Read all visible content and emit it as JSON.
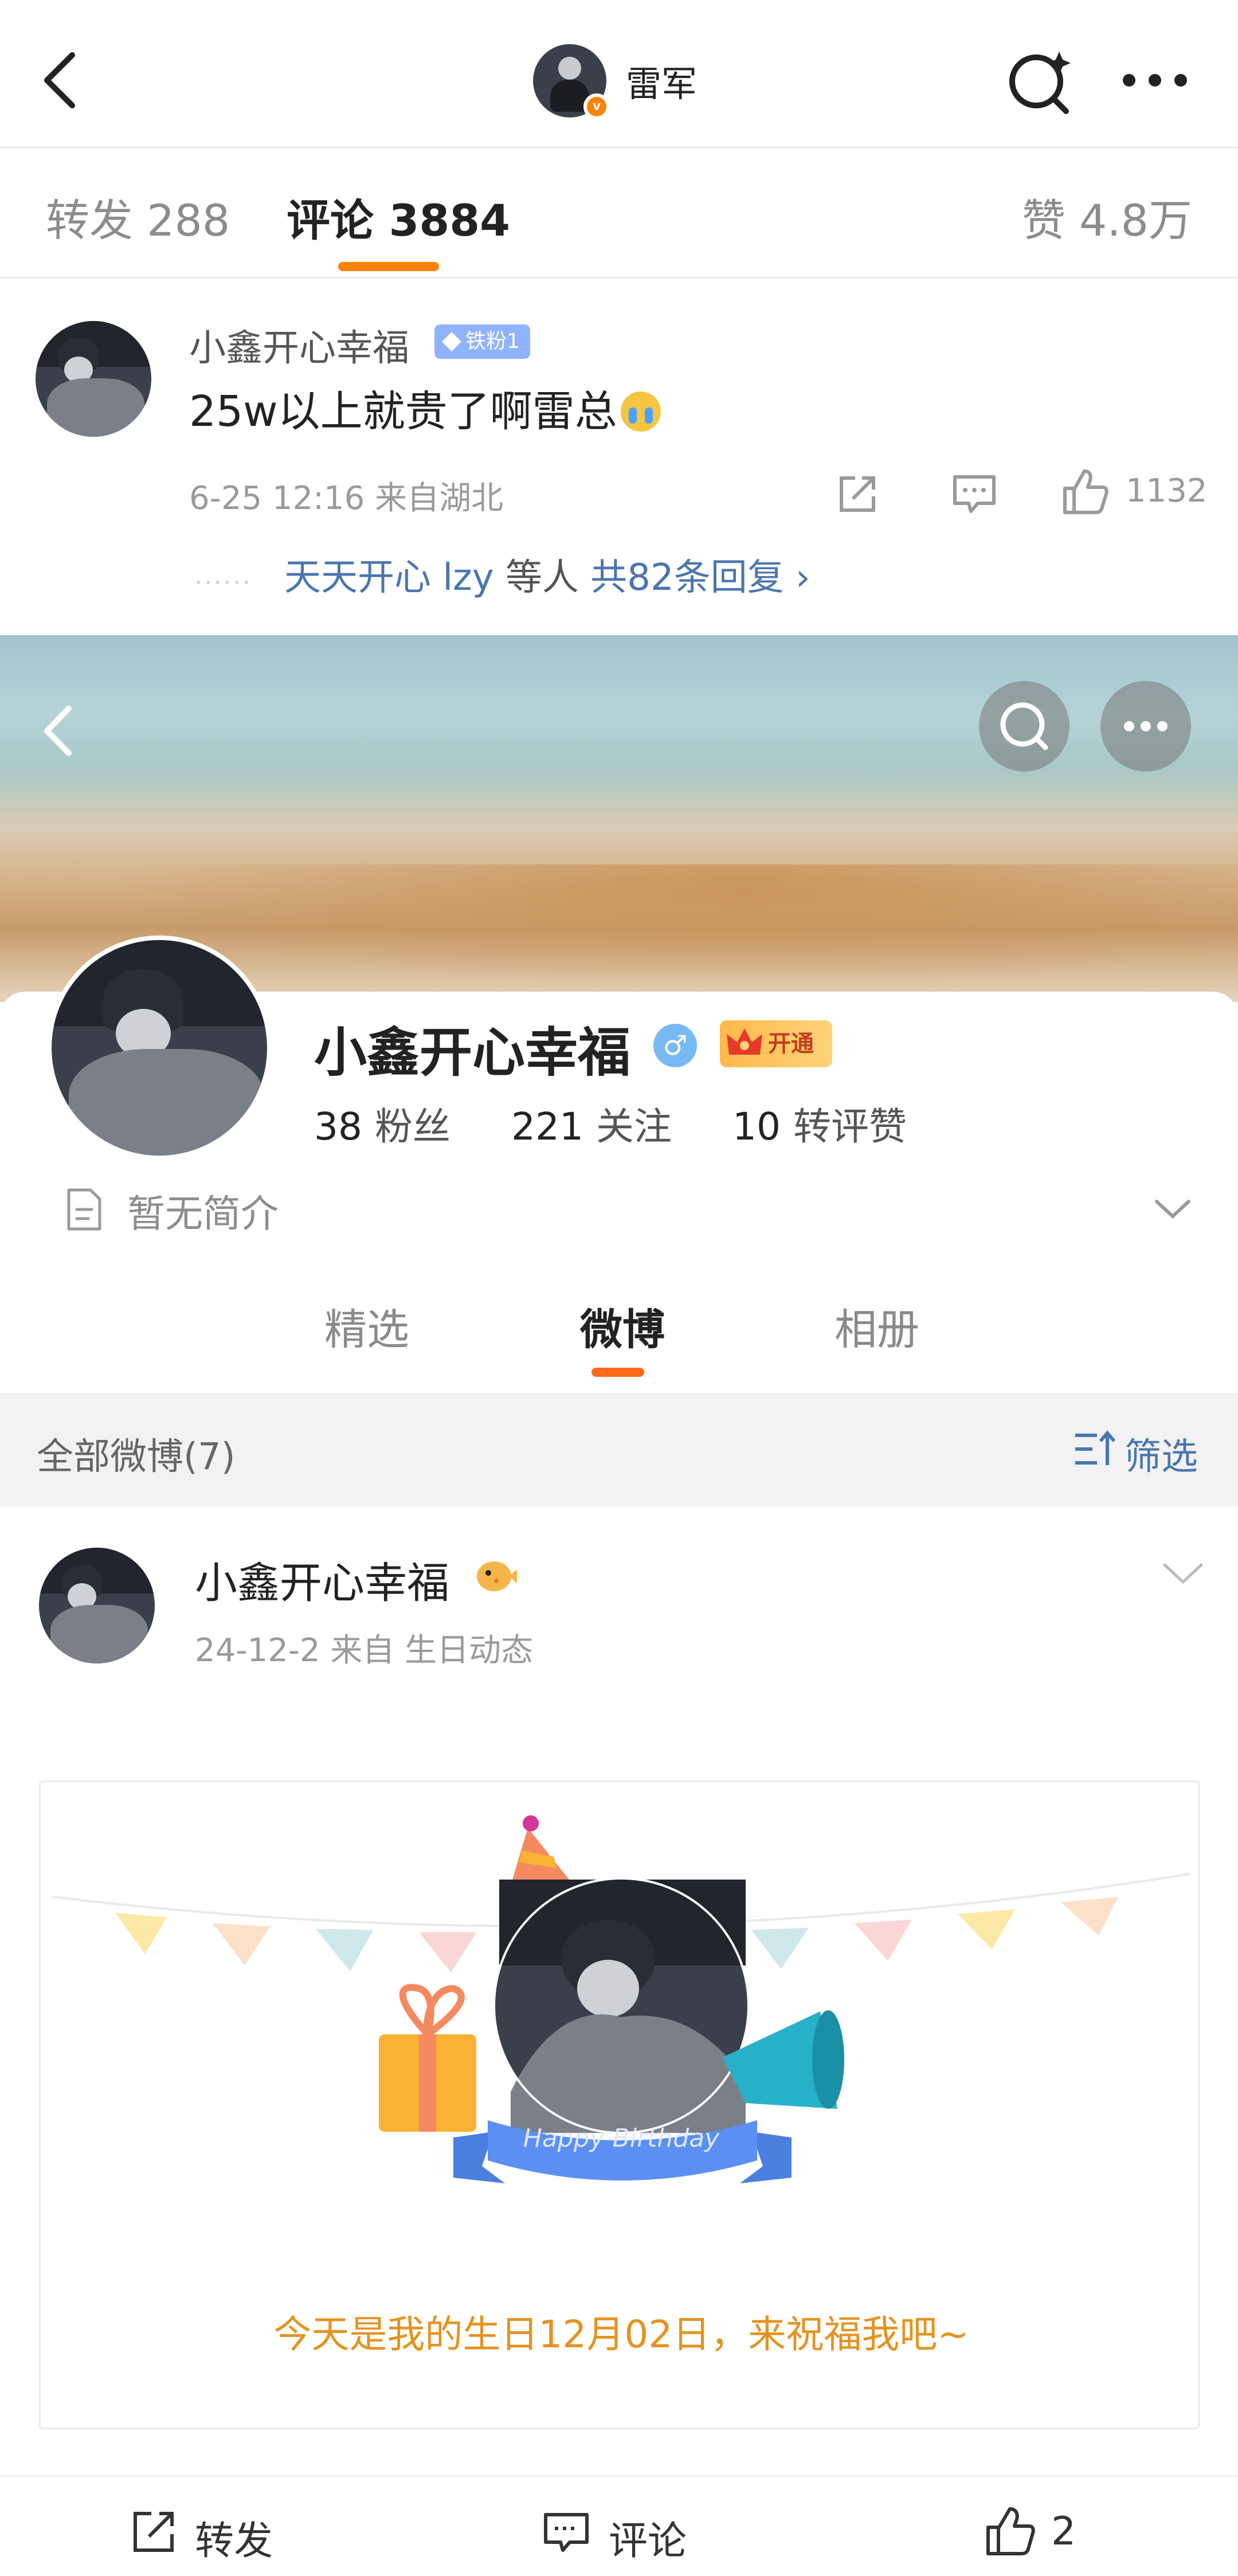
{
  "nav": {
    "username": "雷军",
    "verified_badge": "v"
  },
  "tabs": {
    "forward": "转发 288",
    "comments": "评论 3884",
    "likes": "赞 4.8万"
  },
  "comment": {
    "user": "小鑫开心幸福",
    "fan_badge": "铁粉1",
    "text": "25w以上就贵了啊雷总",
    "meta": "6-25 12:16  来自湖北",
    "like_count": "1132",
    "dots": "······",
    "replies_user": "天天开心 lzy",
    "replies_mid": " 等人 ",
    "replies_total": "共82条回复 ›"
  },
  "profile": {
    "name": "小鑫开心幸福",
    "gender": "♂",
    "vip_label": "开通",
    "followers_n": "38",
    "followers_label": "粉丝",
    "following_n": "221",
    "following_label": "关注",
    "engagement_n": "10",
    "engagement_label": "转评赞",
    "bio": "暂无简介",
    "tabs": [
      "精选",
      "微博",
      "相册"
    ]
  },
  "filter": {
    "all_posts": "全部微博(7)",
    "filter_label": "筛选"
  },
  "post": {
    "name": "小鑫开心幸福",
    "meta": "24-12-2   来自 生日动态",
    "banner_text": "Happy Birthday",
    "birthday_message": "今天是我的生日12月02日，来祝福我吧~",
    "forward_label": "转发",
    "comment_label": "评论",
    "like_count": "2"
  },
  "colors": {
    "accent": "#ff8200",
    "link": "#4a76b0",
    "birthday_text": "#e49320"
  }
}
